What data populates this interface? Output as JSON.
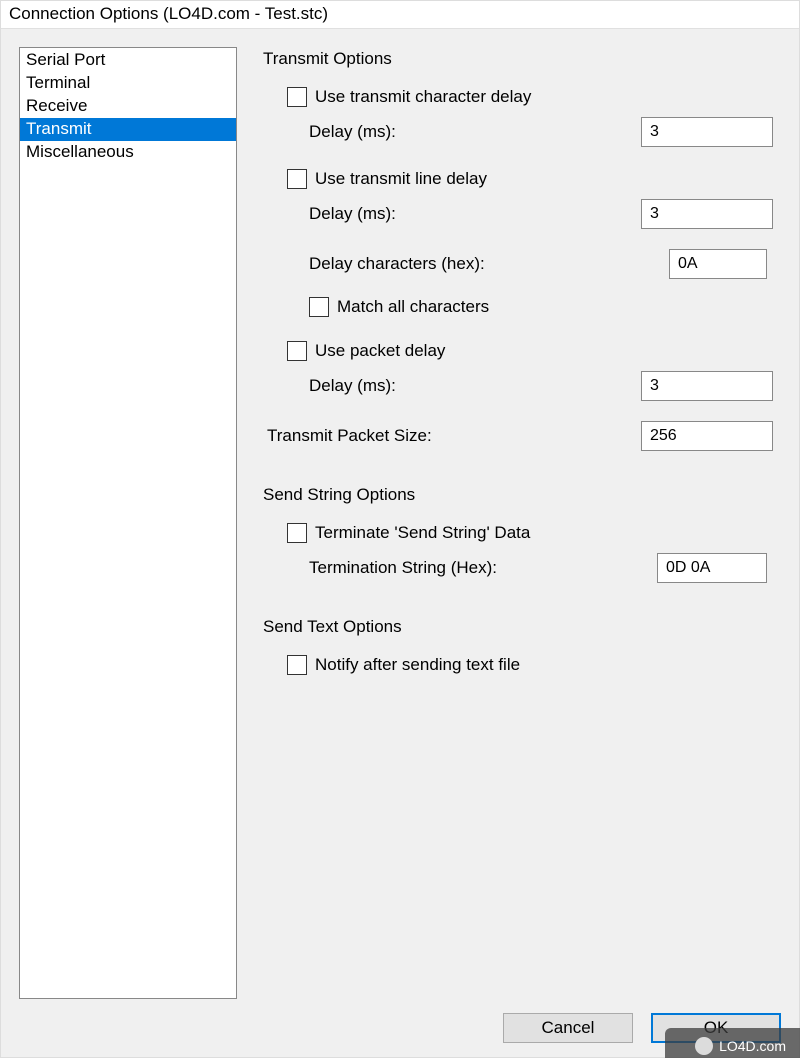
{
  "window": {
    "title": "Connection Options (LO4D.com - Test.stc)"
  },
  "sidebar": {
    "items": [
      {
        "label": "Serial Port",
        "selected": false
      },
      {
        "label": "Terminal",
        "selected": false
      },
      {
        "label": "Receive",
        "selected": false
      },
      {
        "label": "Transmit",
        "selected": true
      },
      {
        "label": "Miscellaneous",
        "selected": false
      }
    ]
  },
  "transmit": {
    "title": "Transmit Options",
    "use_char_delay": {
      "label": "Use transmit character delay",
      "checked": false
    },
    "char_delay": {
      "label": "Delay (ms):",
      "value": "3"
    },
    "use_line_delay": {
      "label": "Use transmit line delay",
      "checked": false
    },
    "line_delay": {
      "label": "Delay (ms):",
      "value": "3"
    },
    "delay_chars": {
      "label": "Delay characters (hex):",
      "value": "0A"
    },
    "match_all": {
      "label": "Match all characters",
      "checked": false
    },
    "use_packet_delay": {
      "label": "Use packet delay",
      "checked": false
    },
    "packet_delay": {
      "label": "Delay (ms):",
      "value": "3"
    },
    "packet_size": {
      "label": "Transmit Packet Size:",
      "value": "256"
    }
  },
  "send_string": {
    "title": "Send String Options",
    "terminate": {
      "label": "Terminate 'Send String' Data",
      "checked": false
    },
    "termination_string": {
      "label": "Termination String (Hex):",
      "value": "0D 0A"
    }
  },
  "send_text": {
    "title": "Send Text Options",
    "notify": {
      "label": "Notify after sending text file",
      "checked": false
    }
  },
  "buttons": {
    "cancel": "Cancel",
    "ok": "OK"
  },
  "watermark": "LO4D.com"
}
